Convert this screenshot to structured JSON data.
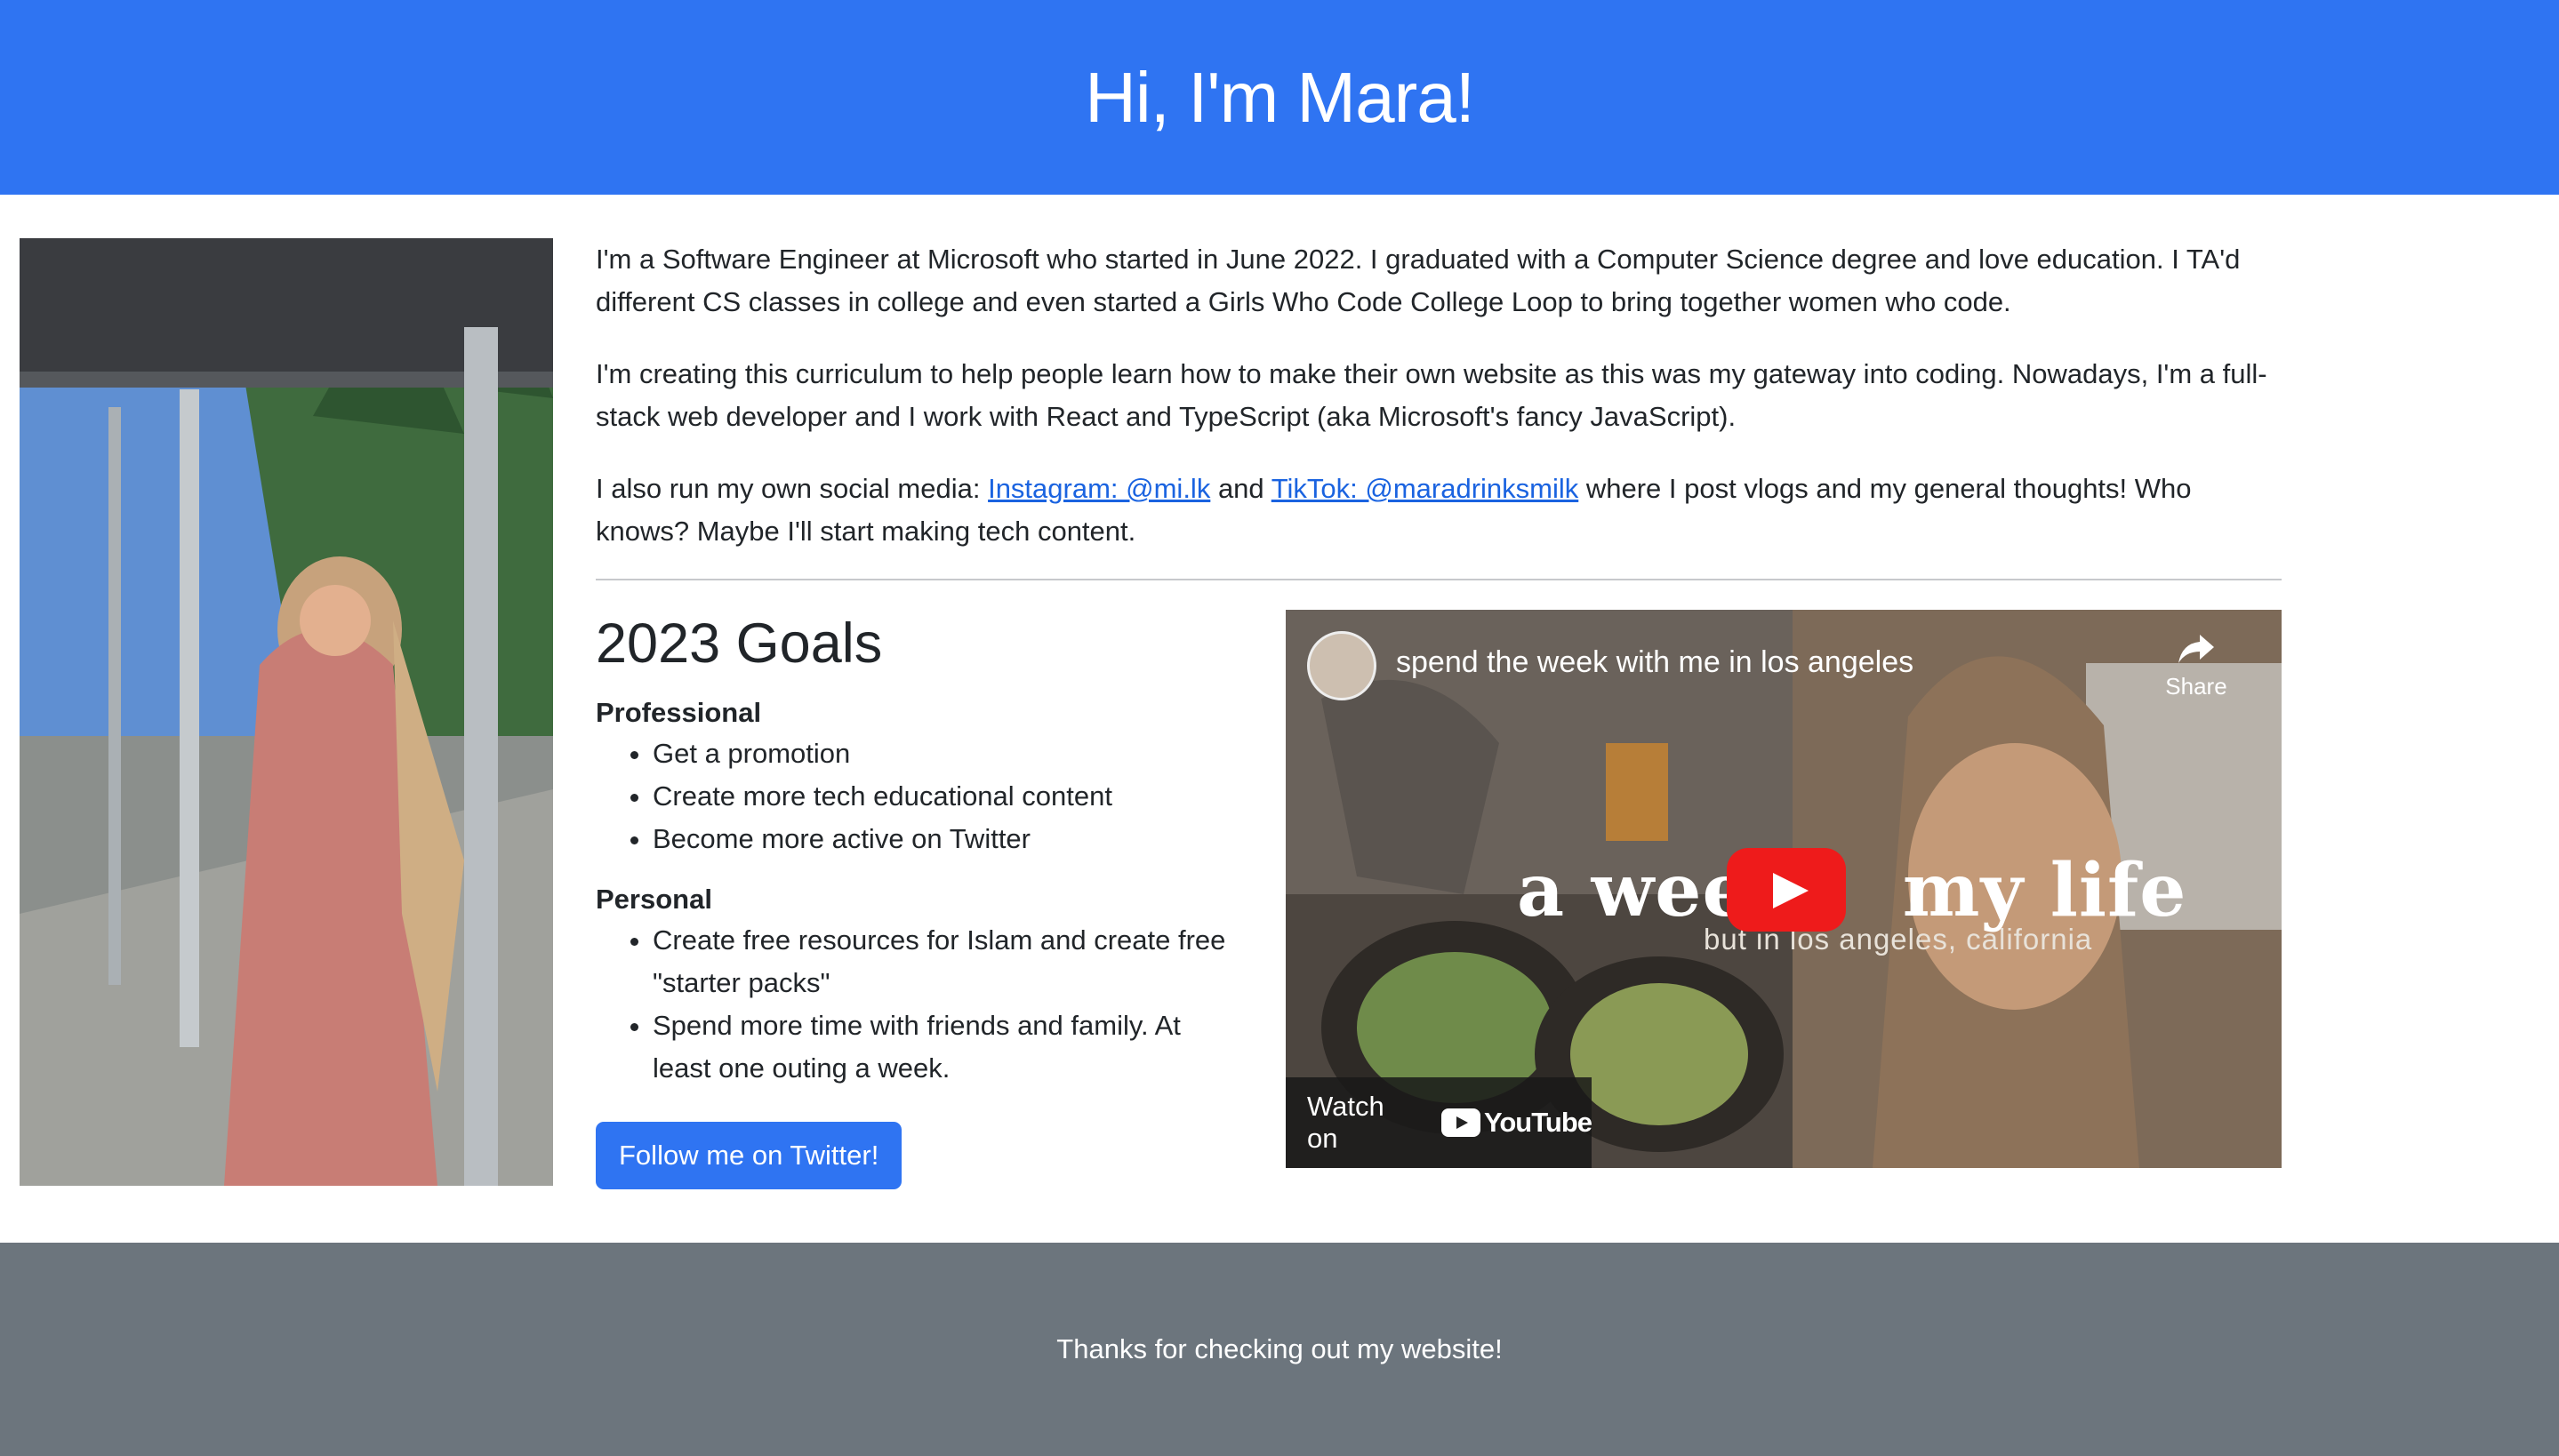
{
  "header": {
    "title": "Hi, I'm Mara!"
  },
  "intro": {
    "p1": "I'm a Software Engineer at Microsoft who started in June 2022. I graduated with a Computer Science degree and love education. I TA'd different CS classes in college and even started a Girls Who Code College Loop to bring together women who code.",
    "p2": "I'm creating this curriculum to help people learn how to make their own website as this was my gateway into coding. Nowadays, I'm a full-stack web developer and I work with React and TypeScript (aka Microsoft's fancy JavaScript).",
    "p3_start": "I also run my own social media: ",
    "instagram_link": "Instagram: @mi.lk",
    "p3_and": " and ",
    "tiktok_link": "TikTok: @maradrinksmilk",
    "p3_end": " where I post vlogs and my general thoughts! Who knows? Maybe I'll start making tech content."
  },
  "goals": {
    "title": "2023 Goals",
    "professional": {
      "heading": "Professional",
      "items": [
        "Get a promotion",
        "Create more tech educational content",
        "Become more active on Twitter"
      ]
    },
    "personal": {
      "heading": "Personal",
      "items": [
        "Create free resources for Islam and create free \"starter packs\"",
        "Spend more time with friends and family. At least one outing a week."
      ]
    },
    "button": "Follow me on Twitter!"
  },
  "video": {
    "title": "spend the week with me in los angeles",
    "share_label": "Share",
    "overlay_text_left": "a weel",
    "overlay_text_right": "my life",
    "subtitle": "but in los angeles, california",
    "watch_on": "Watch on",
    "youtube_logo": "YouTube"
  },
  "footer": {
    "text": "Thanks for checking out my website!"
  },
  "colors": {
    "primary": "#2f74f2",
    "footer": "#6c757d",
    "link": "#1a63e0",
    "play": "#ee1b1b"
  }
}
